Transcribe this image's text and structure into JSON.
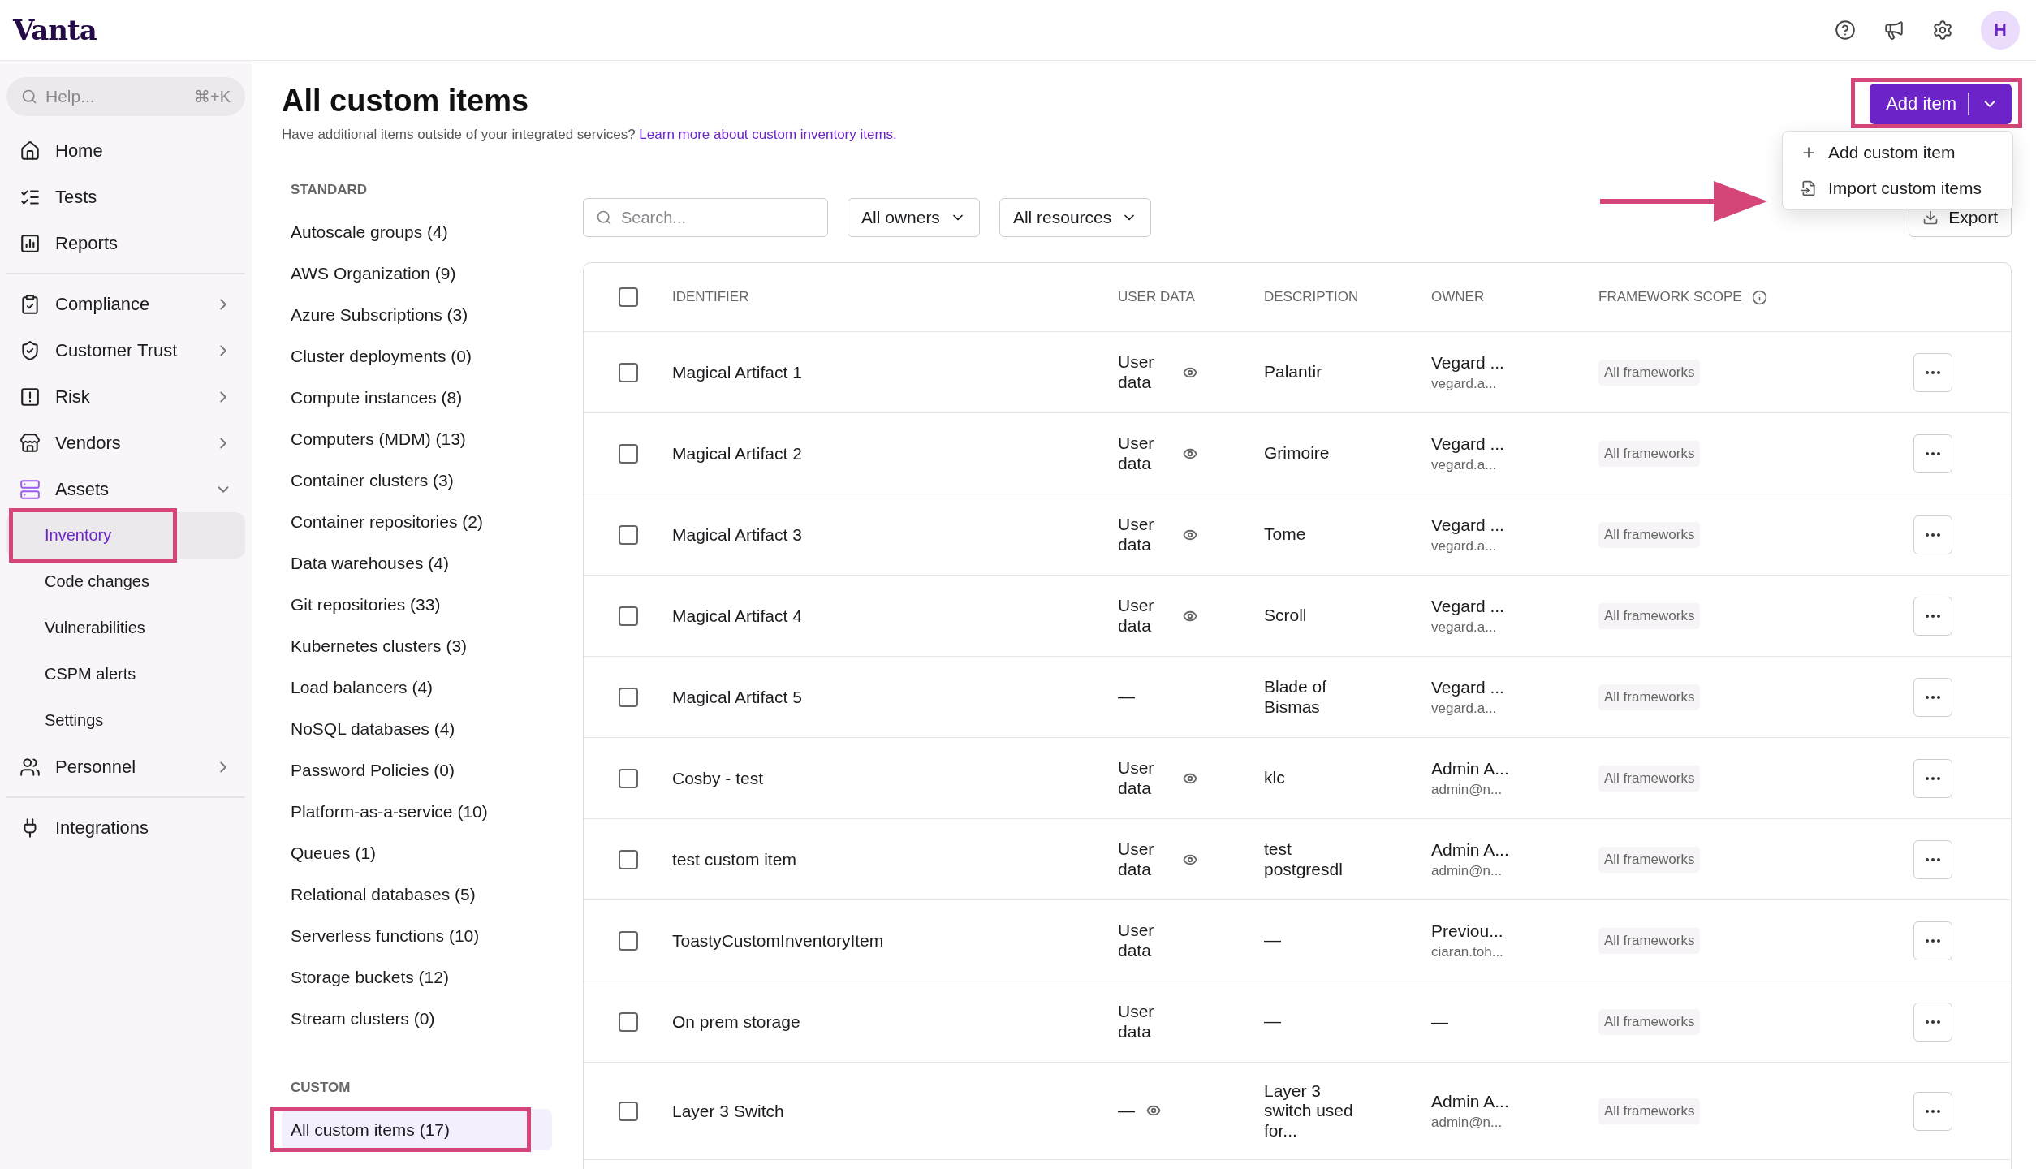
{
  "topbar": {
    "logo": "Vanta",
    "avatar": "H"
  },
  "sidebar": {
    "help": {
      "placeholder": "Help...",
      "shortcut": "⌘+K"
    },
    "sections": [
      [
        {
          "label": "Home"
        },
        {
          "label": "Tests"
        },
        {
          "label": "Reports"
        }
      ],
      [
        {
          "label": "Compliance",
          "expanded": false
        },
        {
          "label": "Customer Trust",
          "expanded": false
        },
        {
          "label": "Risk",
          "expanded": false
        },
        {
          "label": "Vendors",
          "expanded": false
        },
        {
          "label": "Assets",
          "expanded": true,
          "children": [
            {
              "label": "Inventory",
              "selected": true,
              "highlighted": true
            },
            {
              "label": "Code changes",
              "selected": false,
              "highlighted": false
            },
            {
              "label": "Vulnerabilities",
              "selected": false,
              "highlighted": false
            },
            {
              "label": "CSPM alerts",
              "selected": false,
              "highlighted": false
            },
            {
              "label": "Settings",
              "selected": false,
              "highlighted": false
            }
          ]
        },
        {
          "label": "Personnel",
          "expanded": false
        }
      ],
      [
        {
          "label": "Integrations"
        }
      ]
    ]
  },
  "page": {
    "title": "All custom items",
    "subtitle": "Have additional items outside of your integrated services?",
    "subtitle_link": "Learn more about custom inventory items.",
    "add_button": {
      "label": "Add item",
      "expanded": true,
      "highlighted": true,
      "menu": [
        {
          "label": "Add custom item"
        },
        {
          "label": "Import custom items"
        }
      ]
    }
  },
  "categories": [
    {
      "heading": "STANDARD",
      "items": [
        {
          "label": "Autoscale groups (4)",
          "selected": false,
          "highlighted": false
        },
        {
          "label": "AWS Organization (9)",
          "selected": false,
          "highlighted": false
        },
        {
          "label": "Azure Subscriptions (3)",
          "selected": false,
          "highlighted": false
        },
        {
          "label": "Cluster deployments (0)",
          "selected": false,
          "highlighted": false
        },
        {
          "label": "Compute instances (8)",
          "selected": false,
          "highlighted": false
        },
        {
          "label": "Computers (MDM) (13)",
          "selected": false,
          "highlighted": false
        },
        {
          "label": "Container clusters (3)",
          "selected": false,
          "highlighted": false
        },
        {
          "label": "Container repositories (2)",
          "selected": false,
          "highlighted": false
        },
        {
          "label": "Data warehouses (4)",
          "selected": false,
          "highlighted": false
        },
        {
          "label": "Git repositories (33)",
          "selected": false,
          "highlighted": false
        },
        {
          "label": "Kubernetes clusters (3)",
          "selected": false,
          "highlighted": false
        },
        {
          "label": "Load balancers (4)",
          "selected": false,
          "highlighted": false
        },
        {
          "label": "NoSQL databases (4)",
          "selected": false,
          "highlighted": false
        },
        {
          "label": "Password Policies (0)",
          "selected": false,
          "highlighted": false
        },
        {
          "label": "Platform-as-a-service (10)",
          "selected": false,
          "highlighted": false
        },
        {
          "label": "Queues (1)",
          "selected": false,
          "highlighted": false
        },
        {
          "label": "Relational databases (5)",
          "selected": false,
          "highlighted": false
        },
        {
          "label": "Serverless functions (10)",
          "selected": false,
          "highlighted": false
        },
        {
          "label": "Storage buckets (12)",
          "selected": false,
          "highlighted": false
        },
        {
          "label": "Stream clusters (0)",
          "selected": false,
          "highlighted": false
        }
      ]
    },
    {
      "heading": "CUSTOM",
      "items": [
        {
          "label": "All custom items (17)",
          "selected": true,
          "highlighted": true
        }
      ]
    }
  ],
  "toolbar": {
    "search": {
      "placeholder": "Search..."
    },
    "filters": [
      {
        "label": "All owners"
      },
      {
        "label": "All resources"
      }
    ],
    "export": "Export"
  },
  "table": {
    "all_checked": false,
    "columns": [
      {
        "label": "IDENTIFIER",
        "info": false
      },
      {
        "label": "USER DATA",
        "info": false
      },
      {
        "label": "DESCRIPTION",
        "info": false
      },
      {
        "label": "OWNER",
        "info": false
      },
      {
        "label": "FRAMEWORK SCOPE",
        "info": true
      }
    ],
    "rows": [
      {
        "checked": false,
        "identifier": "Magical Artifact 1",
        "user_data": "User data",
        "viewable": true,
        "description": "Palantir",
        "owner": "Vegard ...",
        "owner_email": "vegard.a...",
        "scope": "All frameworks"
      },
      {
        "checked": false,
        "identifier": "Magical Artifact 2",
        "user_data": "User data",
        "viewable": true,
        "description": "Grimoire",
        "owner": "Vegard ...",
        "owner_email": "vegard.a...",
        "scope": "All frameworks"
      },
      {
        "checked": false,
        "identifier": "Magical Artifact 3",
        "user_data": "User data",
        "viewable": true,
        "description": "Tome",
        "owner": "Vegard ...",
        "owner_email": "vegard.a...",
        "scope": "All frameworks"
      },
      {
        "checked": false,
        "identifier": "Magical Artifact 4",
        "user_data": "User data",
        "viewable": true,
        "description": "Scroll",
        "owner": "Vegard ...",
        "owner_email": "vegard.a...",
        "scope": "All frameworks"
      },
      {
        "checked": false,
        "identifier": "Magical Artifact 5",
        "user_data": "—",
        "viewable": false,
        "description": "Blade of Bismas",
        "owner": "Vegard ...",
        "owner_email": "vegard.a...",
        "scope": "All frameworks"
      },
      {
        "checked": false,
        "identifier": "Cosby - test",
        "user_data": "User data",
        "viewable": true,
        "description": "klc",
        "owner": "Admin A...",
        "owner_email": "admin@n...",
        "scope": "All frameworks"
      },
      {
        "checked": false,
        "identifier": "test custom item",
        "user_data": "User data",
        "viewable": true,
        "description": "test postgresdl",
        "owner": "Admin A...",
        "owner_email": "admin@n...",
        "scope": "All frameworks"
      },
      {
        "checked": false,
        "identifier": "ToastyCustomInventoryItem",
        "user_data": "User data",
        "viewable": false,
        "description": "—",
        "owner": "Previou...",
        "owner_email": "ciaran.toh...",
        "scope": "All frameworks"
      },
      {
        "checked": false,
        "identifier": "On prem storage",
        "user_data": "User data",
        "viewable": false,
        "description": "—",
        "owner": "—",
        "scope": "All frameworks"
      },
      {
        "checked": false,
        "identifier": "Layer 3 Switch",
        "user_data": "—",
        "viewable": true,
        "description": "Layer 3 switch used for...",
        "owner": "Admin A...",
        "owner_email": "admin@n...",
        "scope": "All frameworks"
      }
    ]
  }
}
